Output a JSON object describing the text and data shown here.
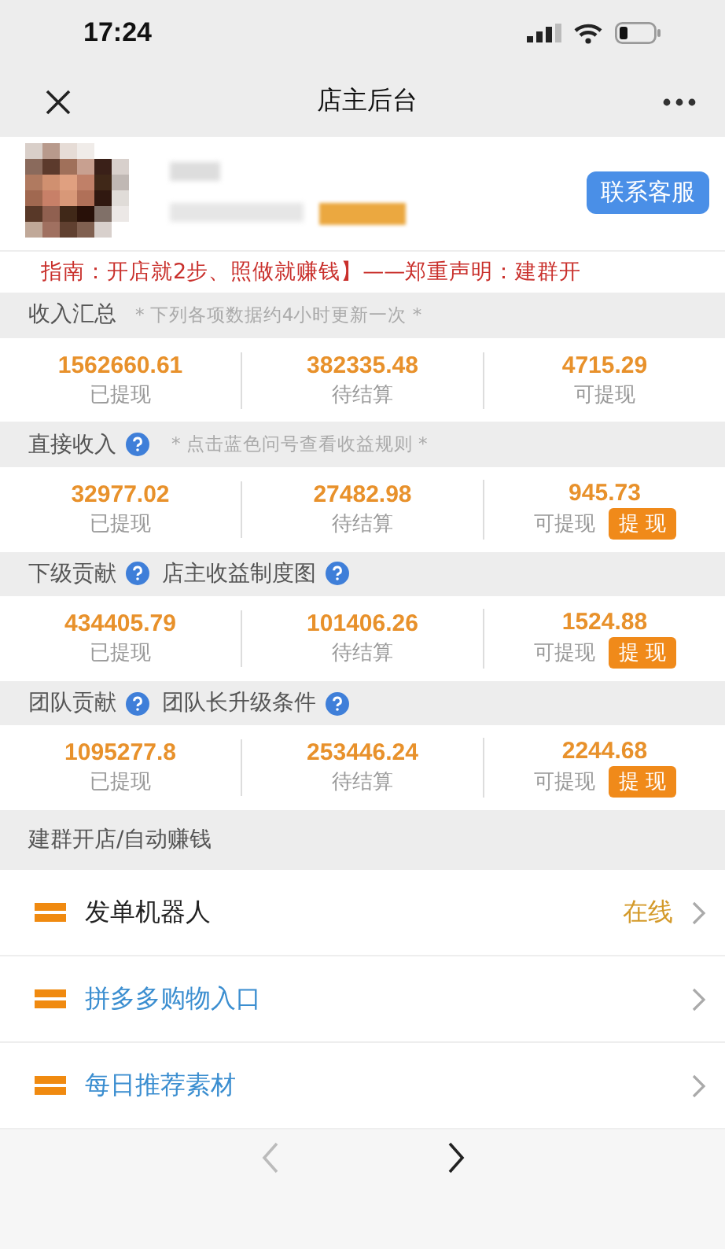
{
  "status_bar": {
    "time": "17:24"
  },
  "nav": {
    "title": "店主后台"
  },
  "profile": {
    "contact_button": "联系客服"
  },
  "notice": "指南：开店就2步、照做就赚钱】——郑重声明：建群开",
  "sections": [
    {
      "title": "收入汇总",
      "help": false,
      "note": "* 下列各项数据约4小时更新一次 *",
      "stats": [
        {
          "value": "1562660.61",
          "label": "已提现"
        },
        {
          "value": "382335.48",
          "label": "待结算"
        },
        {
          "value": "4715.29",
          "label": "可提现"
        }
      ]
    },
    {
      "title": "直接收入",
      "help": true,
      "note": "* 点击蓝色问号查看收益规则 *",
      "stats": [
        {
          "value": "32977.02",
          "label": "已提现"
        },
        {
          "value": "27482.98",
          "label": "待结算"
        },
        {
          "value": "945.73",
          "label": "可提现",
          "button": "提 现"
        }
      ]
    },
    {
      "title": "下级贡献",
      "help": true,
      "link": {
        "text": "店主收益制度图",
        "help": true
      },
      "stats": [
        {
          "value": "434405.79",
          "label": "已提现"
        },
        {
          "value": "101406.26",
          "label": "待结算"
        },
        {
          "value": "1524.88",
          "label": "可提现",
          "button": "提 现"
        }
      ]
    },
    {
      "title": "团队贡献",
      "help": true,
      "link": {
        "text": "团队长升级条件",
        "help": true
      },
      "stats": [
        {
          "value": "1095277.8",
          "label": "已提现"
        },
        {
          "value": "253446.24",
          "label": "待结算"
        },
        {
          "value": "2244.68",
          "label": "可提现",
          "button": "提 现"
        }
      ]
    }
  ],
  "menu": {
    "title": "建群开店/自动赚钱",
    "items": [
      {
        "label": "发单机器人",
        "kind": "plain",
        "status": "在线"
      },
      {
        "label": "拼多多购物入口",
        "kind": "link"
      },
      {
        "label": "每日推荐素材",
        "kind": "link"
      }
    ]
  },
  "browser_bar": {
    "back_disabled": true,
    "forward_disabled": false
  }
}
